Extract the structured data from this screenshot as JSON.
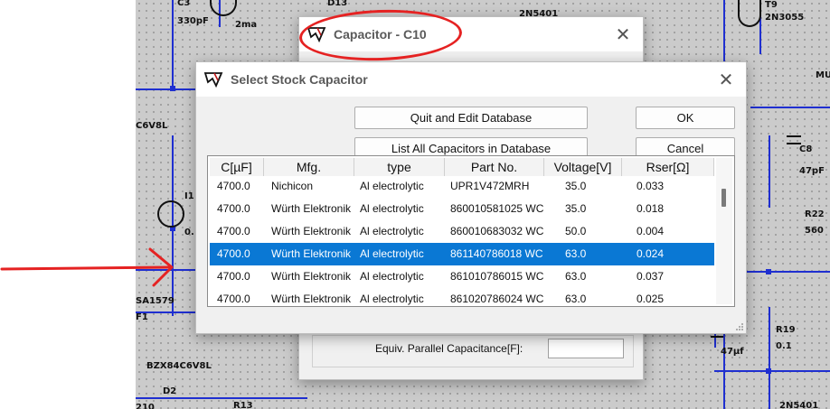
{
  "schematic": {
    "labels": [
      "C3",
      "330pF",
      "2ma",
      "D13",
      "2N5401",
      "T9",
      "2N3055",
      "MU",
      "C6V8L",
      "C8",
      "47pF",
      "R22",
      "560",
      "I1",
      "0.",
      "SA1579",
      "F1",
      "R19",
      "0.1",
      "47µf",
      "BZX84C6V8L",
      "D2",
      "210",
      "R13",
      "2N5401"
    ]
  },
  "capacitor_dialog": {
    "title": "Capacitor - C10",
    "equiv_label": "Equiv. Parallel Capacitance[F]:",
    "equiv_value": ""
  },
  "stock_dialog": {
    "title": "Select Stock Capacitor",
    "buttons": {
      "quit_edit": "Quit and Edit Database",
      "ok": "OK",
      "list_all": "List All Capacitors in Database",
      "cancel": "Cancel"
    },
    "columns": [
      "C[µF]",
      "Mfg.",
      "type",
      "Part No.",
      "Voltage[V]",
      "Rser[Ω]"
    ],
    "rows": [
      [
        "4700.0",
        "Nichicon",
        "Al electrolytic",
        "UPR1V472MRH",
        "35.0",
        "0.033"
      ],
      [
        "4700.0",
        "Würth Elektronik",
        "Al electrolytic",
        "860010581025 WC",
        "35.0",
        "0.018"
      ],
      [
        "4700.0",
        "Würth Elektronik",
        "Al electrolytic",
        "860010683032 WC",
        "50.0",
        "0.004"
      ],
      [
        "4700.0",
        "Würth Elektronik",
        "Al electrolytic",
        "861140786018 WC",
        "63.0",
        "0.024"
      ],
      [
        "4700.0",
        "Würth Elektronik",
        "Al electrolytic",
        "861010786015 WC",
        "63.0",
        "0.037"
      ],
      [
        "4700.0",
        "Würth Elektronik",
        "Al electrolytic",
        "861020786024 WC",
        "63.0",
        "0.025"
      ]
    ],
    "selected_row": 3
  },
  "colors": {
    "selection": "#0a78d4",
    "annotation": "#e52222",
    "wire": "#1f2fd0"
  }
}
